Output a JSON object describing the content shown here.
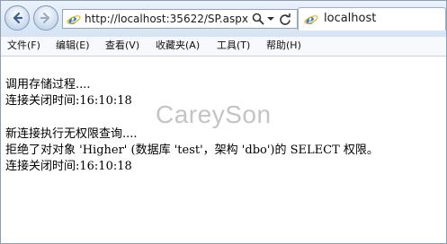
{
  "address": {
    "url": "http://localhost:35622/SP.aspx"
  },
  "tab": {
    "title": "localhost"
  },
  "menu": [
    "文件(F)",
    "编辑(E)",
    "查看(V)",
    "收藏夹(A)",
    "工具(T)",
    "帮助(H)"
  ],
  "content": {
    "lines": [
      "调用存储过程....",
      "连接关闭时间:16:10:18",
      "",
      "新连接执行无权限查询....",
      "拒绝了对对象 'Higher' (数据库 'test'，架构 'dbo')的 SELECT 权限。",
      "连接关闭时间:16:10:18"
    ]
  },
  "watermark": "CareySon",
  "icons": {
    "back": "arrow-left-icon",
    "forward": "arrow-right-icon",
    "page": "ie-logo-icon",
    "search": "search-icon",
    "dropdown": "chevron-down-icon",
    "refresh": "refresh-icon"
  }
}
